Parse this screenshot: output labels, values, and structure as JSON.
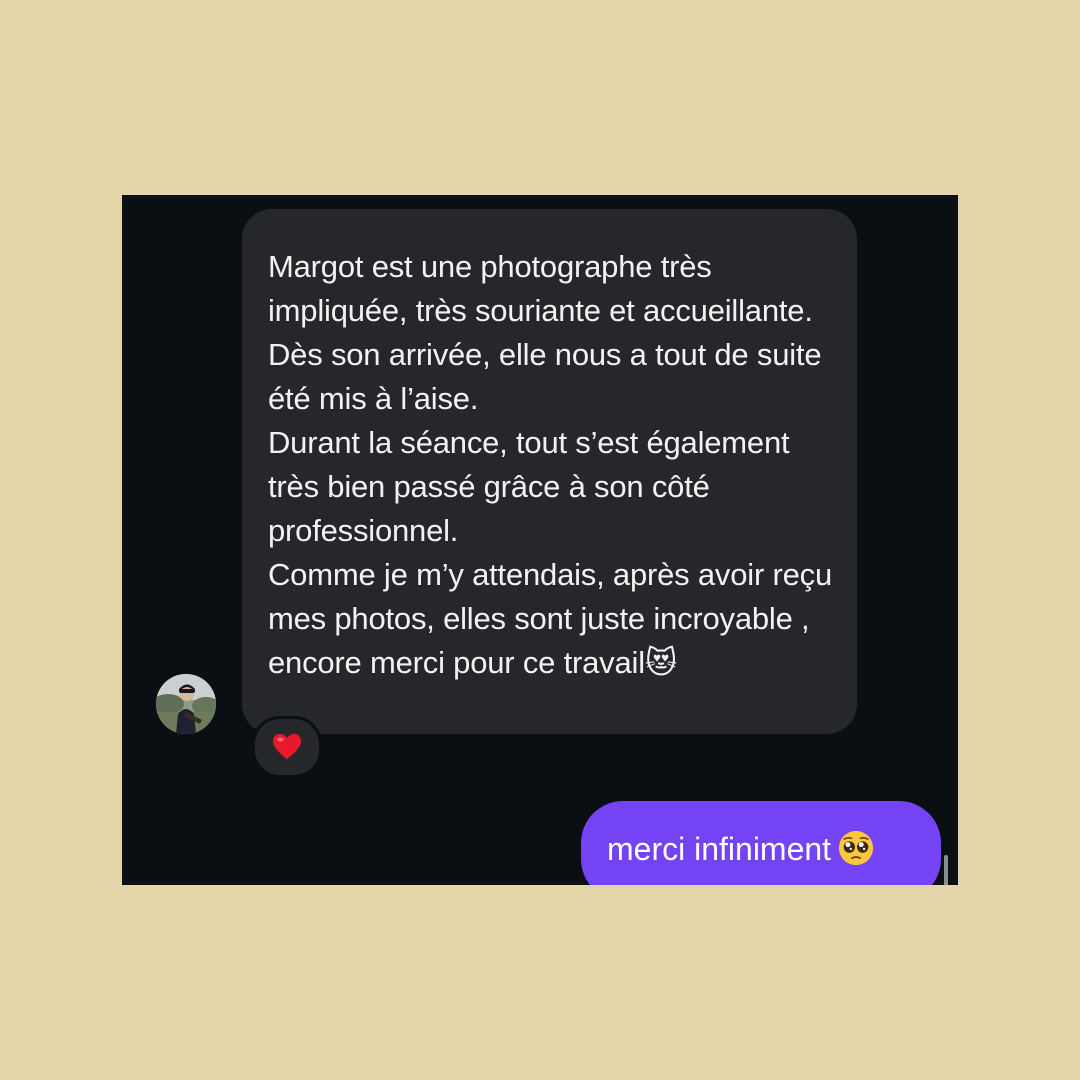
{
  "conversation": {
    "incoming": {
      "paragraphs": [
        "Margot est une photographe très impliquée, très souriante et accueillante. Dès son arrivée, elle nous a tout de suite été mis à l’aise.",
        "Durant la séance, tout s’est également très bien passé grâce à son côté professionnel.",
        "Comme je m’y attendais, après avoir reçu mes photos, elles sont juste incroyable , encore merci pour ce travail"
      ],
      "trailing_emoji": "😻",
      "reaction_icon": "red-heart",
      "avatar_icon": "rider-profile-photo"
    },
    "outgoing": {
      "text": "merci infiniment",
      "trailing_emoji": "pleading-face"
    }
  },
  "colors": {
    "page_background": "#e3d4a9",
    "chat_background": "#0b0e12",
    "incoming_bubble": "#25272b",
    "outgoing_bubble": "#7443f4"
  }
}
